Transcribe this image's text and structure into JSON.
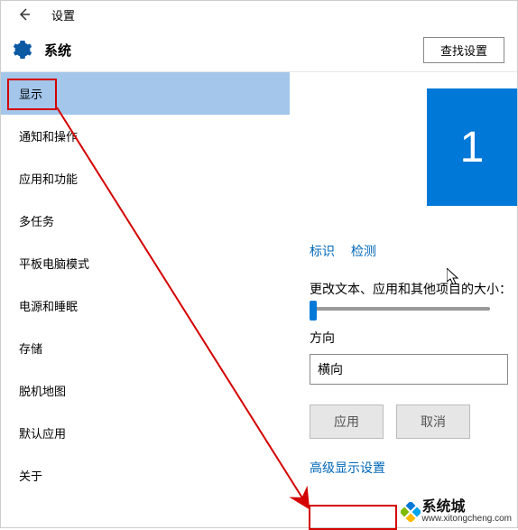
{
  "titlebar": {
    "title": "设置"
  },
  "header": {
    "title": "系统",
    "find_label": "查找设置"
  },
  "sidebar": {
    "items": [
      {
        "label": "显示",
        "selected": true
      },
      {
        "label": "通知和操作"
      },
      {
        "label": "应用和功能"
      },
      {
        "label": "多任务"
      },
      {
        "label": "平板电脑模式"
      },
      {
        "label": "电源和睡眠"
      },
      {
        "label": "存储"
      },
      {
        "label": "脱机地图"
      },
      {
        "label": "默认应用"
      },
      {
        "label": "关于"
      }
    ]
  },
  "main": {
    "monitor_number": "1",
    "identify_label": "标识",
    "detect_label": "检测",
    "resize_label": "更改文本、应用和其他项目的大小：",
    "orientation_label": "方向",
    "orientation_value": "横向",
    "apply_label": "应用",
    "cancel_label": "取消",
    "advanced_label": "高级显示设置"
  },
  "watermark": {
    "cn": "系统城",
    "url": "www.xitongcheng.com"
  },
  "colors": {
    "accent": "#0078d7",
    "link": "#0067b8",
    "red": "#d40000"
  }
}
